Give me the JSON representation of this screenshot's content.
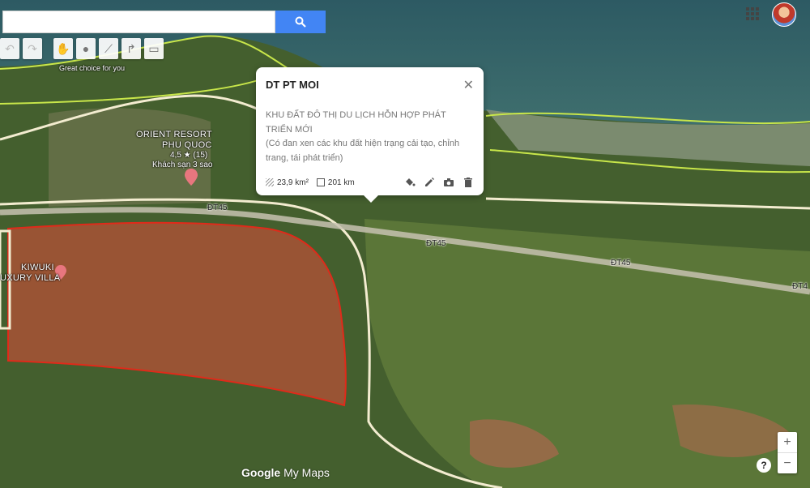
{
  "search": {
    "value": "",
    "placeholder": ""
  },
  "toolbar": {
    "items": [
      {
        "icon": "undo-icon",
        "glyph": "↶"
      },
      {
        "icon": "redo-icon",
        "glyph": "↷"
      },
      {
        "icon": "hand-icon",
        "glyph": "✋"
      },
      {
        "icon": "marker-icon",
        "glyph": "●"
      },
      {
        "icon": "draw-line-icon",
        "glyph": "⟋"
      },
      {
        "icon": "directions-icon",
        "glyph": "↱"
      },
      {
        "icon": "ruler-icon",
        "glyph": "▭"
      }
    ]
  },
  "map": {
    "slogan": "Great choice for you",
    "poi_orient_name_1": "ORIENT RESORT",
    "poi_orient_name_2": "PHU QUOC",
    "poi_orient_rating": "4,5 ★ (15)",
    "poi_orient_type": "Khách sạn 3 sao",
    "poi_kiwuki_1": "KIWUKI",
    "poi_kiwuki_2": "UXURY VILLA",
    "road_1": "ĐT45",
    "road_2": "ĐT45",
    "road_3": "ĐT45",
    "road_4": "ĐT4",
    "polygon_color": "#e04a3a",
    "boundary_color": "#c8e64a"
  },
  "popup": {
    "title": "DT PT MOI",
    "description": "KHU ĐẤT ĐÔ THỊ DU LỊCH HỖN HỢP PHÁT TRIỂN MỚI\n(Có đan xen các khu đất hiện trạng cải tạo, chỉnh trang, tái phát triển)",
    "area": "23,9 km²",
    "length": "201 km"
  },
  "controls": {
    "zoom_in": "+",
    "zoom_out": "−",
    "help": "?"
  },
  "branding": {
    "google": "Google",
    "mymaps": "My Maps"
  }
}
